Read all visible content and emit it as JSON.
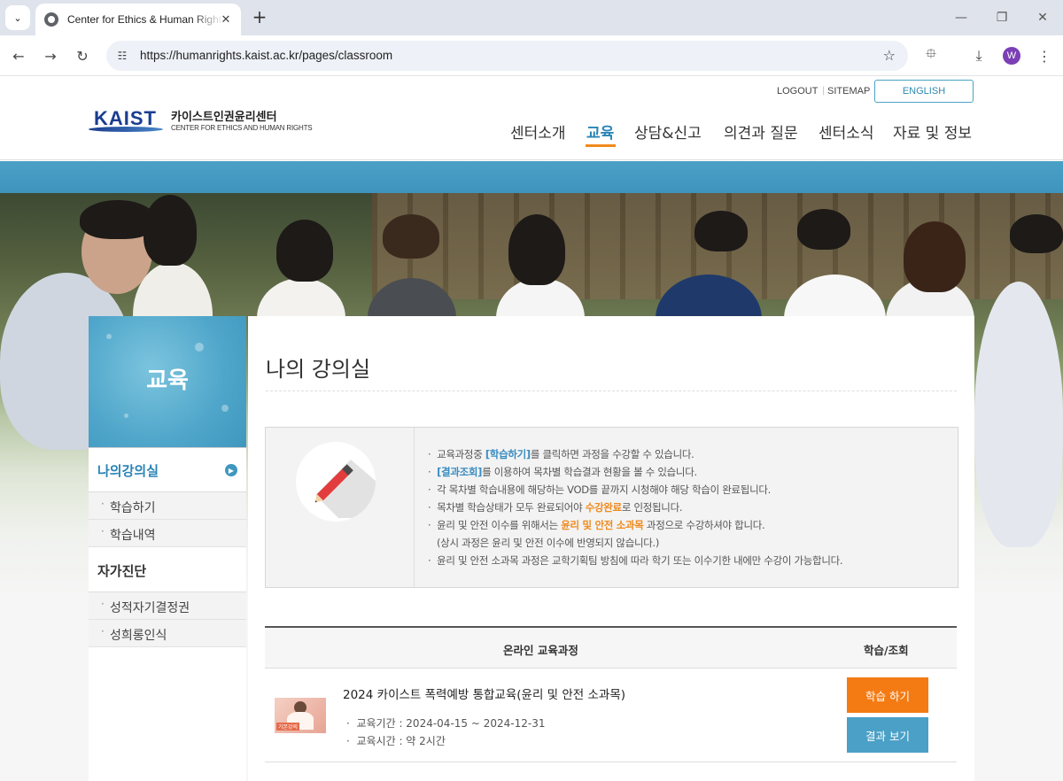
{
  "browser": {
    "tab_title": "Center for Ethics & Human Rights",
    "url": "https://humanrights.kaist.ac.kr/pages/classroom",
    "profile_initial": "W"
  },
  "site": {
    "logo_mark": "KAIST",
    "logo_ko": "카이스트인권윤리센터",
    "logo_en": "CENTER FOR ETHICS AND HUMAN RIGHTS",
    "util_logout": "LOGOUT",
    "util_sep": "|",
    "util_sitemap": "SITEMAP",
    "english": "ENGLISH",
    "gnb": [
      "센터소개",
      "교육",
      "상담&신고",
      "의견과 질문",
      "센터소식",
      "자료 및 정보"
    ],
    "gnb_active_index": 1
  },
  "sidebar": {
    "title": "교육",
    "sections": [
      {
        "label": "나의강의실",
        "active": true,
        "items": [
          "학습하기",
          "학습내역"
        ]
      },
      {
        "label": "자가진단",
        "active": false,
        "items": [
          "성적자기결정권",
          "성희롱인식"
        ]
      }
    ],
    "bullet": "·"
  },
  "content": {
    "title": "나의 강의실",
    "info": {
      "l1_pre": "교육과정중 ",
      "l1_hl": "[학습하기]",
      "l1_post": "를 클릭하면 과정을 수강할 수 있습니다.",
      "l2_hl": "[결과조회]",
      "l2_post": "를 이용하여 목차별 학습결과 현황을 볼 수 있습니다.",
      "l3": "각 목차별 학습내용에 해당하는 VOD를 끝까지 시청해야 해당 학습이 완료됩니다.",
      "l4_pre": "목차별 학습상태가 모두 완료되어야 ",
      "l4_hl": "수강완료",
      "l4_post": "로 인정됩니다.",
      "l5_pre": "윤리 및 안전 이수를 위해서는 ",
      "l5_hl": "윤리 및 안전 소과목",
      "l5_post": " 과정으로 수강하셔야 합니다.",
      "l6": "(상시 과정은 윤리 및 안전 이수에 반영되지 않습니다.)",
      "l7": "윤리 및 안전 소과목 과정은 교학기획팀 방침에 따라 학기 또는 이수기한 내에만 수강이 가능합니다.",
      "dot": "·"
    },
    "table": {
      "col_course": "온라인 교육과정",
      "col_action": "학습/조회",
      "rows": [
        {
          "thumb_tag": "기본강의",
          "title": "2024 카이스트 폭력예방 통합교육(윤리 및 안전 소과목)",
          "period": "교육기간 : 2024-04-15 ~ 2024-12-31",
          "duration": "교육시간 : 약 2시간",
          "study_btn": "학습 하기",
          "result_btn": "결과 보기"
        }
      ]
    }
  },
  "colors": {
    "accent_blue": "#4aa0c6",
    "accent_orange": "#f47b14",
    "nav_active": "#2a84b6"
  }
}
